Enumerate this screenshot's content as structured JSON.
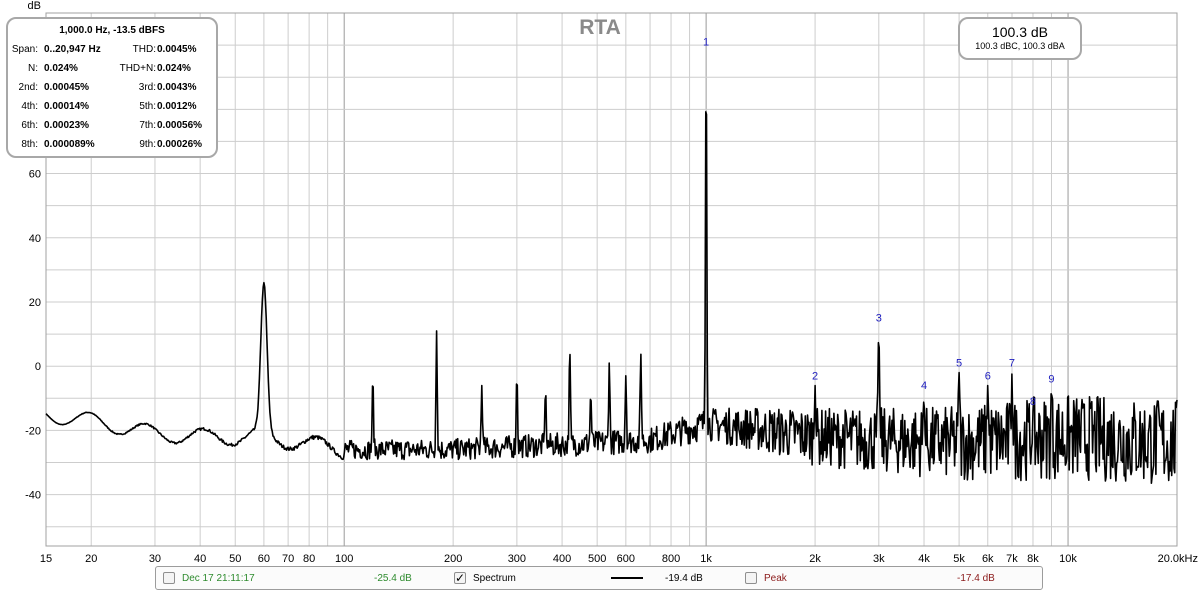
{
  "chart_data": {
    "type": "line",
    "title": "RTA",
    "ylabel": "dB",
    "xlabel": "",
    "x_scale": "log",
    "xlim": [
      15,
      20000
    ],
    "ylim": [
      -56,
      110
    ],
    "grid": true,
    "y_ticks": [
      -40,
      -20,
      0,
      20,
      40,
      60,
      80
    ],
    "x_ticks": [
      {
        "v": 15,
        "label": "15"
      },
      {
        "v": 20,
        "label": "20"
      },
      {
        "v": 30,
        "label": "30"
      },
      {
        "v": 40,
        "label": "40"
      },
      {
        "v": 50,
        "label": "50"
      },
      {
        "v": 60,
        "label": "60"
      },
      {
        "v": 70,
        "label": "70"
      },
      {
        "v": 80,
        "label": "80"
      },
      {
        "v": 100,
        "label": "100"
      },
      {
        "v": 200,
        "label": "200"
      },
      {
        "v": 300,
        "label": "300"
      },
      {
        "v": 400,
        "label": "400"
      },
      {
        "v": 500,
        "label": "500"
      },
      {
        "v": 600,
        "label": "600"
      },
      {
        "v": 800,
        "label": "800"
      },
      {
        "v": 1000,
        "label": "1k"
      },
      {
        "v": 2000,
        "label": "2k"
      },
      {
        "v": 3000,
        "label": "3k"
      },
      {
        "v": 4000,
        "label": "4k"
      },
      {
        "v": 5000,
        "label": "5k"
      },
      {
        "v": 6000,
        "label": "6k"
      },
      {
        "v": 7000,
        "label": "7k"
      },
      {
        "v": 8000,
        "label": "8k"
      },
      {
        "v": 10000,
        "label": "10k"
      },
      {
        "v": 20000,
        "label": "20.0kHz"
      }
    ],
    "series": [
      {
        "name": "Spectrum",
        "color": "#000000",
        "baseline": [
          [
            15,
            -15
          ],
          [
            20,
            -17
          ],
          [
            30,
            -21
          ],
          [
            40,
            -22
          ],
          [
            60,
            -22
          ],
          [
            100,
            -26
          ],
          [
            200,
            -26
          ],
          [
            300,
            -25
          ],
          [
            500,
            -24
          ],
          [
            700,
            -23
          ],
          [
            1000,
            -18
          ],
          [
            1500,
            -20
          ],
          [
            2000,
            -22
          ],
          [
            3000,
            -23
          ],
          [
            5000,
            -24
          ],
          [
            10000,
            -22
          ],
          [
            20000,
            -24
          ]
        ],
        "noise_dB": [
          [
            15,
            0
          ],
          [
            100,
            3
          ],
          [
            700,
            4
          ],
          [
            1000,
            5
          ],
          [
            2000,
            9
          ],
          [
            4000,
            11
          ],
          [
            8000,
            13
          ],
          [
            20000,
            14
          ]
        ],
        "peaks": [
          [
            60,
            26
          ],
          [
            120,
            -3
          ],
          [
            180,
            11
          ],
          [
            240,
            -6
          ],
          [
            300,
            -2
          ],
          [
            360,
            -7
          ],
          [
            420,
            6
          ],
          [
            480,
            -8
          ],
          [
            540,
            1
          ],
          [
            600,
            -3
          ],
          [
            660,
            4
          ],
          [
            1000,
            98
          ],
          [
            2000,
            -6
          ],
          [
            3000,
            12
          ],
          [
            4000,
            -9
          ],
          [
            5000,
            -2
          ],
          [
            6000,
            -6
          ],
          [
            7000,
            -2
          ],
          [
            8000,
            -14
          ],
          [
            9000,
            -7
          ]
        ]
      }
    ],
    "harmonic_markers": [
      {
        "label": "1",
        "f": 1000,
        "y": 98
      },
      {
        "label": "2",
        "f": 2000,
        "y": -6
      },
      {
        "label": "3",
        "f": 3000,
        "y": 12
      },
      {
        "label": "4",
        "f": 4000,
        "y": -9
      },
      {
        "label": "5",
        "f": 5000,
        "y": -2
      },
      {
        "label": "6",
        "f": 6000,
        "y": -6
      },
      {
        "label": "7",
        "f": 7000,
        "y": -2
      },
      {
        "label": "8",
        "f": 8000,
        "y": -14
      },
      {
        "label": "9",
        "f": 9000,
        "y": -7
      }
    ]
  },
  "distortion": {
    "header": "1,000.0 Hz, -13.5 dBFS",
    "rows": [
      {
        "l1": "Span:",
        "v1": "0..20,947 Hz",
        "l2": "THD:",
        "v2": "0.0045%"
      },
      {
        "l1": "N:",
        "v1": "0.024%",
        "l2": "THD+N:",
        "v2": "0.024%"
      },
      {
        "l1": "2nd:",
        "v1": "0.00045%",
        "l2": "3rd:",
        "v2": "0.0043%"
      },
      {
        "l1": "4th:",
        "v1": "0.00014%",
        "l2": "5th:",
        "v2": "0.0012%"
      },
      {
        "l1": "6th:",
        "v1": "0.00023%",
        "l2": "7th:",
        "v2": "0.00056%"
      },
      {
        "l1": "8th:",
        "v1": "0.000089%",
        "l2": "9th:",
        "v2": "0.00026%"
      }
    ]
  },
  "level": {
    "main": "100.3 dB",
    "sub": "100.3 dBC, 100.3 dBA"
  },
  "legend": {
    "items": [
      {
        "label": "Dec 17 21:11:17",
        "value": "-25.4 dB",
        "checked": false,
        "color": "#2e8b2e"
      },
      {
        "label": "Spectrum",
        "value": "-19.4 dB",
        "checked": true,
        "color": "#000000"
      },
      {
        "label": "Peak",
        "value": "-17.4 dB",
        "checked": false,
        "color": "#8b1a1a"
      }
    ],
    "check_glyph": "✓"
  },
  "colors": {
    "grid": "#cdcdcd",
    "grid_major": "#9a9a9a",
    "frame": "#a0a0a0",
    "title": "#8a8a8a",
    "marker": "#1c1cbe"
  }
}
